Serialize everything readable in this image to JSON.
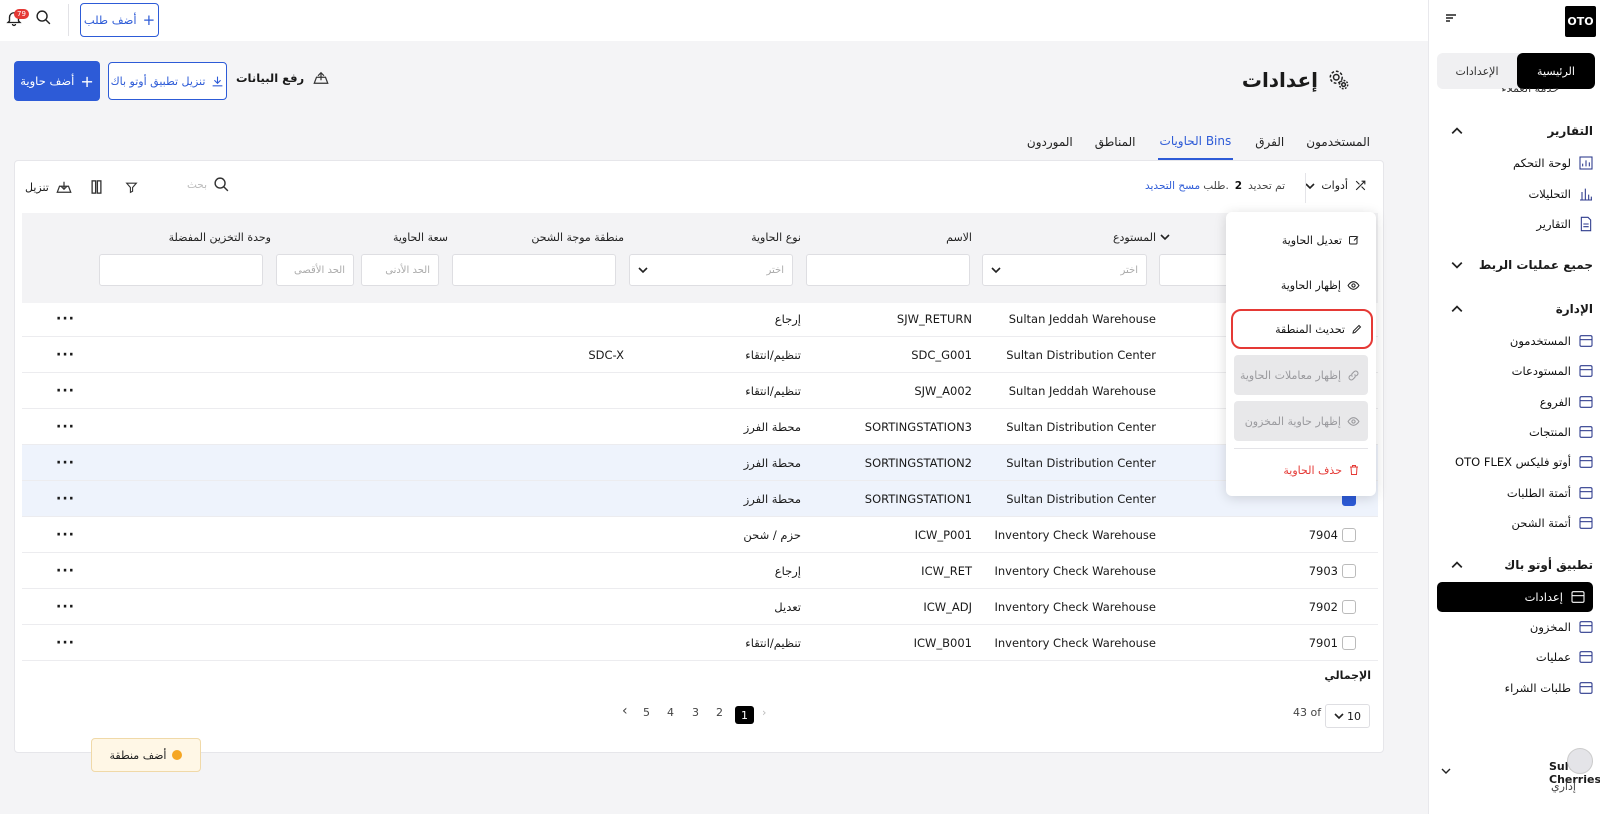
{
  "brand": {
    "logo": "OTO"
  },
  "sidebar": {
    "tab_home": "الرئيسية",
    "tab_settings": "الإعدادات",
    "partial_item": "خدمة العملاء",
    "section_reports": "التقارير",
    "reports_items": [
      "لوحة التحكم",
      "التحليلات",
      "التقارير"
    ],
    "section_integrations": "جميع عمليات الربط",
    "section_admin": "الإدارة",
    "admin_items": [
      "المستخدمون",
      "المستودعات",
      "الفروع",
      "المنتجات",
      "OTO FLEX أوتو فليكس",
      "أتمتة الطلبات",
      "أتمتة الشحن"
    ],
    "section_app": "تطبيق أوتو باك",
    "app_items": [
      "إعدادات",
      "المخزون",
      "عمليات",
      "طلبات الشراء"
    ],
    "user_name": "Sultan Cherries",
    "user_role": "إداري"
  },
  "topbar": {
    "notif_count": "79",
    "add_order": "أضف طلب"
  },
  "header": {
    "title": "إعدادات",
    "add_bin": "أضف حاوية",
    "download_app": "تنزيل تطبيق أوتو باك",
    "upload_data": "رفع البيانات"
  },
  "tabs": [
    "المستخدمون",
    "الفرق",
    "الحاويات Bins",
    "المناطق",
    "الموردون"
  ],
  "toolbar": {
    "tools": "أدوات",
    "selected_prefix": "تم تحديد",
    "selected_count": "2",
    "selected_suffix": "طلب.",
    "clear": "مسح التحديد",
    "search_placeholder": "بحث",
    "download": "تنزيل"
  },
  "columns": {
    "warehouse": "المستودع",
    "name": "الاسم",
    "bin_type": "نوع الحاوية",
    "wave_zone": "منطقة موجة الشحن",
    "capacity": "سعة الحاوية",
    "preferred_unit": "وحدة التخزين المفضلة"
  },
  "filters": {
    "choose": "اختر",
    "min": "الحد الأدنى",
    "max": "الحد الأقصى"
  },
  "rows": [
    {
      "id": "",
      "warehouse": "Sultan Jeddah Warehouse",
      "name": "SJW_RETURN",
      "type": "إرجاع",
      "zone": "",
      "checked": false,
      "hl": false
    },
    {
      "id": "",
      "warehouse": "Sultan Distribution Center",
      "name": "SDC_G001",
      "type": "تنظيم/انتقاء",
      "zone": "SDC-X",
      "checked": false,
      "hl": false
    },
    {
      "id": "",
      "warehouse": "Sultan Jeddah Warehouse",
      "name": "SJW_A002",
      "type": "تنظيم/انتقاء",
      "zone": "",
      "checked": false,
      "hl": false
    },
    {
      "id": "",
      "warehouse": "Sultan Distribution Center",
      "name": "SORTINGSTATION3",
      "type": "محطة الفرز",
      "zone": "",
      "checked": false,
      "hl": false
    },
    {
      "id": "",
      "warehouse": "Sultan Distribution Center",
      "name": "SORTINGSTATION2",
      "type": "محطة الفرز",
      "zone": "",
      "checked": true,
      "hl": true
    },
    {
      "id": "",
      "warehouse": "Sultan Distribution Center",
      "name": "SORTINGSTATION1",
      "type": "محطة الفرز",
      "zone": "",
      "checked": true,
      "hl": true
    },
    {
      "id": "7904",
      "warehouse": "Inventory Check Warehouse",
      "name": "ICW_P001",
      "type": "حزم / شحن",
      "zone": "",
      "checked": false,
      "hl": false
    },
    {
      "id": "7903",
      "warehouse": "Inventory Check Warehouse",
      "name": "ICW_RET",
      "type": "إرجاع",
      "zone": "",
      "checked": false,
      "hl": false
    },
    {
      "id": "7902",
      "warehouse": "Inventory Check Warehouse",
      "name": "ICW_ADJ",
      "type": "تعديل",
      "zone": "",
      "checked": false,
      "hl": false
    },
    {
      "id": "7901",
      "warehouse": "Inventory Check Warehouse",
      "name": "ICW_B001",
      "type": "تنظيم/انتقاء",
      "zone": "",
      "checked": false,
      "hl": false
    }
  ],
  "menu": {
    "edit": "تعديل الحاوية",
    "show": "إظهار الحاوية",
    "update_zone": "تحديث المنطقة",
    "show_tx": "إظهار معاملات الحاوية",
    "show_stock": "إظهار حاوية المخزون",
    "delete": "حذف الحاوية"
  },
  "footer": {
    "total": "الإجمالي",
    "page_size": "10",
    "of_total": "43 of",
    "pages": [
      "1",
      "2",
      "3",
      "4",
      "5"
    ],
    "add_zone": "أضف منطقة"
  },
  "colors": {
    "accent": "#2d5bd7",
    "danger": "#e53935",
    "dark": "#000000"
  }
}
